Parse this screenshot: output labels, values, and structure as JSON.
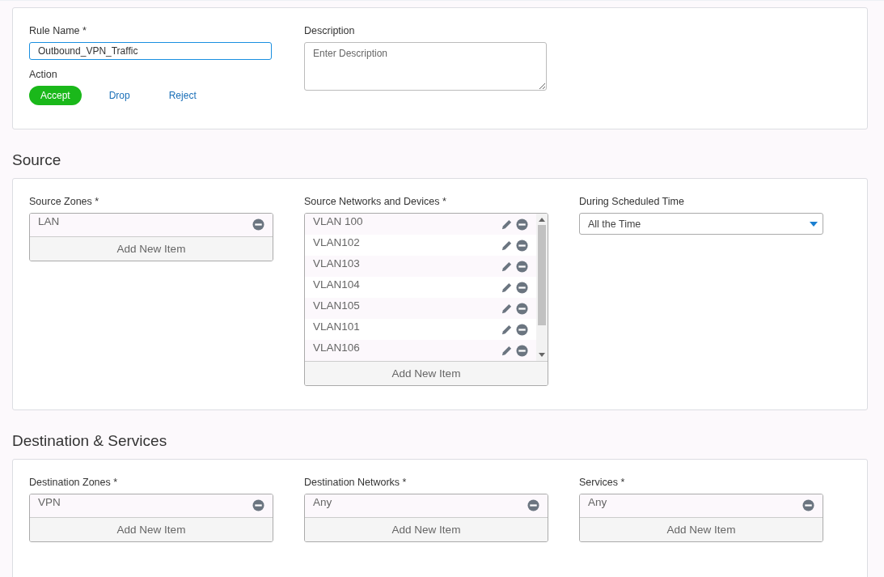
{
  "rule": {
    "name_label": "Rule Name *",
    "name_value": "Outbound_VPN_Traffic",
    "description_label": "Description",
    "description_placeholder": "Enter Description",
    "action_label": "Action",
    "actions": [
      {
        "label": "Accept",
        "selected": true
      },
      {
        "label": "Drop",
        "selected": false
      },
      {
        "label": "Reject",
        "selected": false
      }
    ]
  },
  "sections": [
    {
      "title": "Source",
      "fields": [
        {
          "kind": "list",
          "label": "Source Zones *",
          "scrollbar": false,
          "items": [
            {
              "text": "LAN",
              "editable": false
            }
          ],
          "add_label": "Add New Item"
        },
        {
          "kind": "list",
          "label": "Source Networks and Devices *",
          "scrollbar": true,
          "items": [
            {
              "text": "VLAN 100",
              "editable": true
            },
            {
              "text": "VLAN102",
              "editable": true
            },
            {
              "text": "VLAN103",
              "editable": true
            },
            {
              "text": "VLAN104",
              "editable": true
            },
            {
              "text": "VLAN105",
              "editable": true
            },
            {
              "text": "VLAN101",
              "editable": true
            },
            {
              "text": "VLAN106",
              "editable": true
            }
          ],
          "add_label": "Add New Item"
        },
        {
          "kind": "select",
          "label": "During Scheduled Time",
          "value": "All the Time"
        }
      ]
    },
    {
      "title": "Destination & Services",
      "fields": [
        {
          "kind": "list",
          "label": "Destination Zones *",
          "scrollbar": false,
          "items": [
            {
              "text": "VPN",
              "editable": false
            }
          ],
          "add_label": "Add New Item"
        },
        {
          "kind": "list",
          "label": "Destination Networks *",
          "scrollbar": false,
          "items": [
            {
              "text": "Any",
              "editable": false
            }
          ],
          "add_label": "Add New Item"
        },
        {
          "kind": "list",
          "label": "Services *",
          "scrollbar": false,
          "items": [
            {
              "text": "Any",
              "editable": false
            }
          ],
          "add_label": "Add New Item"
        }
      ]
    }
  ]
}
